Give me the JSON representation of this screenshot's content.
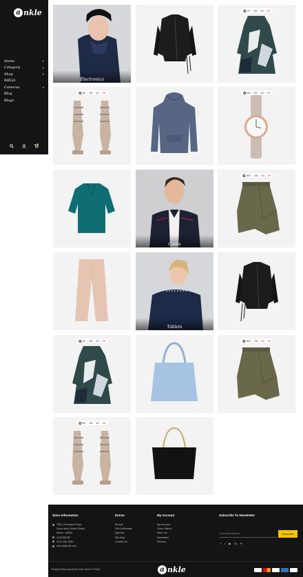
{
  "brand": {
    "logo_letter": "a",
    "logo_rest": "nkle"
  },
  "sidebar": {
    "menu": [
      {
        "label": "Home",
        "has_submenu": true
      },
      {
        "label": "Category",
        "has_submenu": true
      },
      {
        "label": "Shop",
        "has_submenu": true
      },
      {
        "label": "MEGA",
        "has_submenu": false
      },
      {
        "label": "Cameras",
        "has_submenu": true
      },
      {
        "label": "Blog",
        "has_submenu": false
      },
      {
        "label": "Blogs",
        "has_submenu": false
      }
    ],
    "icons": [
      "search-icon",
      "user-icon",
      "cart-icon"
    ]
  },
  "timer_sep": ":",
  "tiles": [
    {
      "kind": "category",
      "label": "Electronics",
      "image": "woman-in-beanie-coat"
    },
    {
      "kind": "product",
      "image": "black-biker-jacket"
    },
    {
      "kind": "product",
      "image": "abstract-print-dress",
      "timer": [
        "47",
        "05",
        "13",
        "29"
      ]
    },
    {
      "kind": "product",
      "image": "strappy-sandals",
      "timer": [
        "81",
        "05",
        "13",
        "29"
      ]
    },
    {
      "kind": "product",
      "image": "blue-hoodie"
    },
    {
      "kind": "product",
      "image": "rose-gold-watch",
      "timer": [
        "65",
        "05",
        "13",
        "29"
      ]
    },
    {
      "kind": "product",
      "image": "teal-blouse"
    },
    {
      "kind": "category",
      "label": "Cases",
      "image": "man-in-jacket"
    },
    {
      "kind": "product",
      "image": "olive-asymmetric-skirt",
      "timer": [
        "347",
        "05",
        "13",
        "29"
      ]
    },
    {
      "kind": "product",
      "image": "beige-trousers"
    },
    {
      "kind": "category",
      "label": "Tablets",
      "image": "woman-in-navy-top"
    },
    {
      "kind": "product",
      "image": "black-biker-jacket"
    },
    {
      "kind": "product",
      "image": "abstract-print-dress",
      "timer": [
        "47",
        "05",
        "13",
        "29"
      ]
    },
    {
      "kind": "product",
      "image": "light-blue-tote-bag"
    },
    {
      "kind": "product",
      "image": "olive-asymmetric-skirt",
      "timer": [
        "347",
        "05",
        "13",
        "29"
      ]
    },
    {
      "kind": "product",
      "image": "strappy-sandals",
      "timer": [
        "81",
        "05",
        "13",
        "29"
      ]
    },
    {
      "kind": "product",
      "image": "black-leather-tote"
    }
  ],
  "footer": {
    "store": {
      "heading": "Store Information",
      "lines": [
        "7354, Demoland Road",
        "Demo store United States",
        "Illinois - 60606",
        "0123456789",
        "0123-456-7890",
        "demo@gmail.com"
      ]
    },
    "extras": {
      "heading": "Extras",
      "links": [
        "Brands",
        "Gift Certificates",
        "Specials",
        "Site Map",
        "Contact Us"
      ]
    },
    "account": {
      "heading": "My Account",
      "links": [
        "My Account",
        "Order History",
        "Wish List",
        "Newsletter",
        "Returns"
      ]
    },
    "newsletter": {
      "heading": "Subscribe To Newsletter",
      "placeholder": "Your email address",
      "button": "Subscribe",
      "social": [
        "f",
        "t",
        "▶",
        "◎",
        "P"
      ]
    },
    "powered": "Powered By OpenCart Your Store © 2024",
    "payments": [
      "visa",
      "mastercard",
      "discover",
      "amex",
      "paypal"
    ]
  },
  "colors": {
    "dark": "#141414",
    "accent": "#f5c30a",
    "timer_red": "#e02020",
    "tile_bg": "#f3f3f3"
  }
}
